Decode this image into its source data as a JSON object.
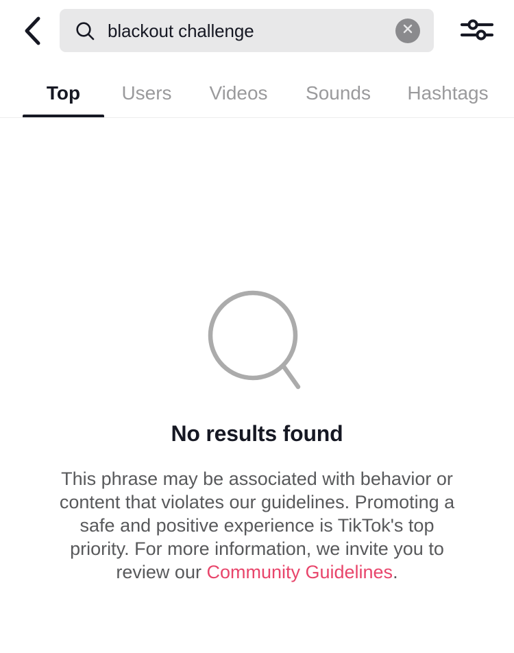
{
  "header": {
    "back_icon": "chevron-left-icon",
    "search": {
      "icon": "search-icon",
      "value": "blackout challenge",
      "placeholder": "Search",
      "clear_icon": "close-circle-icon"
    },
    "filter_icon": "filter-sliders-icon"
  },
  "tabs": {
    "items": [
      {
        "label": "Top",
        "active": true
      },
      {
        "label": "Users",
        "active": false
      },
      {
        "label": "Videos",
        "active": false
      },
      {
        "label": "Sounds",
        "active": false
      },
      {
        "label": "Hashtags",
        "active": false
      }
    ]
  },
  "empty_state": {
    "icon": "magnifier-large-icon",
    "title": "No results found",
    "body_part1": "This phrase may be associated with behavior or content that violates our guidelines. Promoting a safe and positive experience is TikTok's top priority. For more information, we invite you to review our ",
    "link_text": "Community Guidelines",
    "body_part2": "."
  },
  "colors": {
    "accent_link": "#e8456b",
    "text_primary": "#161823",
    "text_secondary": "#58595b",
    "text_muted": "#9a9a9c",
    "search_bg": "#e8e8e9",
    "clear_bg": "#8a8a8d",
    "icon_gray": "#ababab",
    "background": "#ffffff"
  }
}
